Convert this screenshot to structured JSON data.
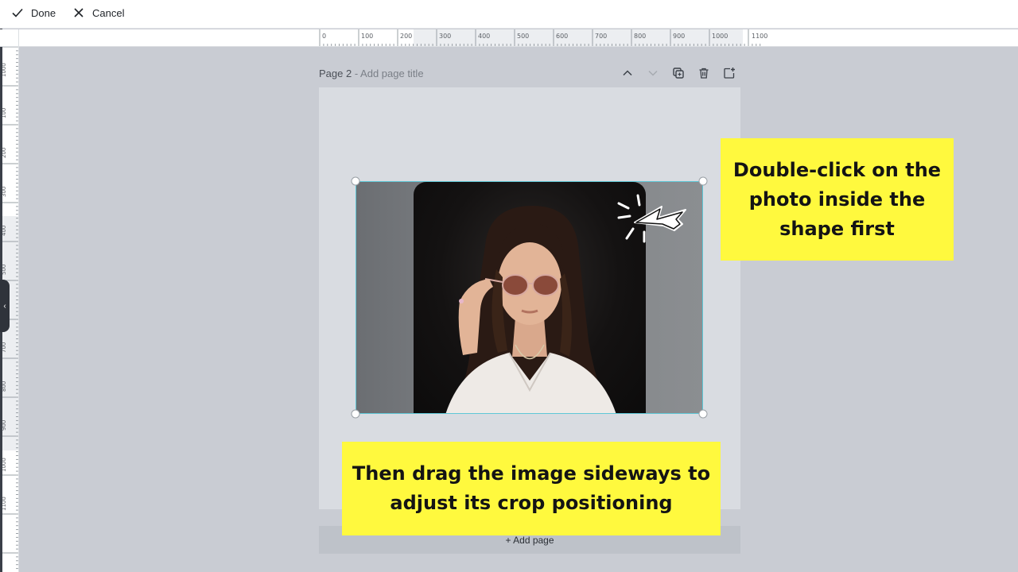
{
  "toolbar": {
    "done_label": "Done",
    "cancel_label": "Cancel"
  },
  "ruler": {
    "x_labels": [
      "0",
      "100",
      "200",
      "300",
      "400",
      "500",
      "600",
      "700",
      "800",
      "900",
      "1000",
      "1100"
    ],
    "y_labels": [
      "1000",
      "100",
      "200",
      "300",
      "400",
      "500",
      "600",
      "700",
      "800",
      "900",
      "1000",
      "1100"
    ]
  },
  "page": {
    "title": "Page 2",
    "title_separator": " - ",
    "title_placeholder": "Add page title",
    "actions": [
      "chevron-up-icon",
      "chevron-down-icon",
      "duplicate-icon",
      "trash-icon",
      "add-page-icon"
    ],
    "add_page_label": "+ Add page"
  },
  "callouts": {
    "first": "Double-click on the photo inside the shape first",
    "second": "Then drag the image sideways to adjust its crop positioning"
  },
  "colors": {
    "callout_bg": "#fff93e",
    "selection": "#5fc7d6",
    "canvas_bg": "#c9ccd3",
    "page_bg": "#d9dce1"
  }
}
